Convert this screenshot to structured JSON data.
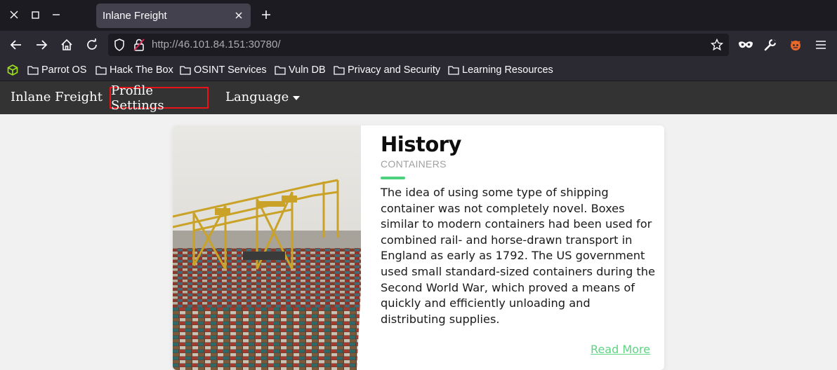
{
  "browser": {
    "tab_title": "Inlane Freight",
    "url_host": "http://46.101.84.151",
    "url_port_path": ":30780/",
    "bookmarks": [
      "Parrot OS",
      "Hack The Box",
      "OSINT Services",
      "Vuln DB",
      "Privacy and Security",
      "Learning Resources"
    ]
  },
  "site_nav": {
    "brand": "Inlane Freight",
    "profile_settings": "Profile Settings",
    "language": "Language"
  },
  "card": {
    "title": "History",
    "subtitle": "CONTAINERS",
    "accent": "#4cd17c",
    "body": "The idea of using some type of shipping container was not completely novel. Boxes similar to modern containers had been used for combined rail- and horse-drawn transport in England as early as 1792. The US government used small standard-sized containers during the Second World War, which proved a means of quickly and efficiently unloading and distributing supplies.",
    "read_more": "Read More"
  }
}
